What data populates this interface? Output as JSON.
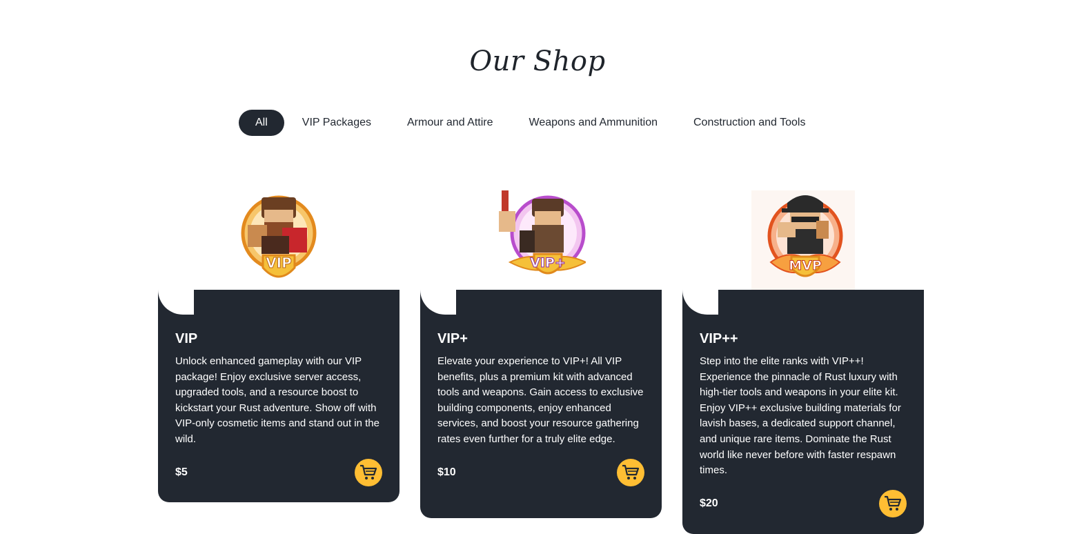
{
  "shop": {
    "title": "Our Shop",
    "filters": [
      {
        "label": "All",
        "active": true
      },
      {
        "label": "VIP Packages",
        "active": false
      },
      {
        "label": "Armour and Attire",
        "active": false
      },
      {
        "label": "Weapons and Ammunition",
        "active": false
      },
      {
        "label": "Construction and Tools",
        "active": false
      }
    ],
    "products": [
      {
        "name": "VIP",
        "badge_text": "VIP",
        "badge_color": "#f0a030",
        "description": "Unlock enhanced gameplay with our VIP package! Enjoy exclusive server access, upgraded tools, and a resource boost to kickstart your Rust adventure. Show off with VIP-only cosmetic items and stand out in the wild.",
        "price": "$5",
        "cart_icon": "cart-icon"
      },
      {
        "name": "VIP+",
        "badge_text": "VIP+",
        "badge_color": "#c060d8",
        "description": "Elevate your experience to VIP+! All VIP benefits, plus a premium kit with advanced tools and weapons. Gain access to exclusive building components, enjoy enhanced services, and boost your resource gathering rates even further for a truly elite edge.",
        "price": "$10",
        "cart_icon": "cart-icon"
      },
      {
        "name": "VIP++",
        "badge_text": "MVP",
        "badge_color": "#f06a2a",
        "description": "Step into the elite ranks with VIP++! Experience the pinnacle of Rust luxury with high-tier tools and weapons in your elite kit. Enjoy VIP++ exclusive building materials for lavish bases, a dedicated support channel, and unique rare items. Dominate the Rust world like never before with faster respawn times.",
        "price": "$20",
        "cart_icon": "cart-icon"
      }
    ]
  },
  "colors": {
    "dark": "#222831",
    "accent": "#ffbe33",
    "background": "#ffffff"
  }
}
